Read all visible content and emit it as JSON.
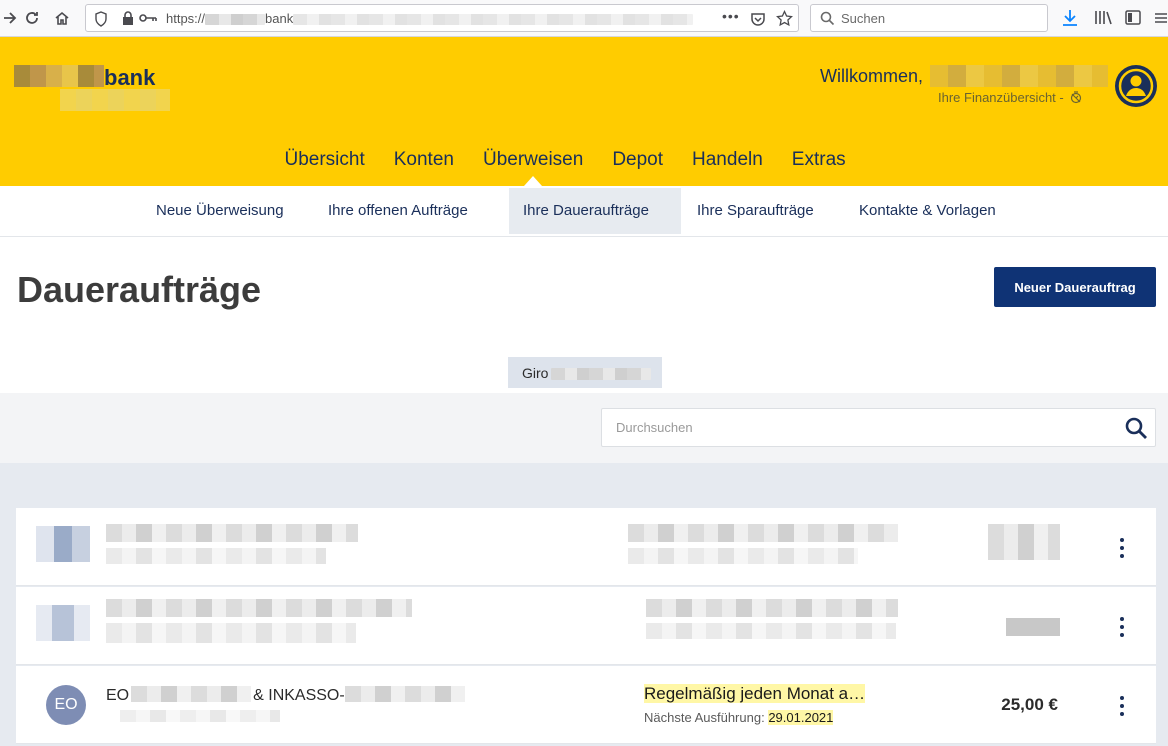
{
  "browser": {
    "url_prefix": "https://",
    "url_visible": "bank",
    "search_placeholder": "Suchen"
  },
  "header": {
    "logo_text": "bank",
    "welcome": "Willkommen,",
    "fin_overview": "Ihre Finanzübersicht -"
  },
  "main_nav": [
    "Übersicht",
    "Konten",
    "Überweisen",
    "Depot",
    "Handeln",
    "Extras"
  ],
  "sub_nav": [
    "Neue Überweisung",
    "Ihre offenen Aufträge",
    "Ihre Daueraufträge",
    "Ihre Sparaufträge",
    "Kontakte & Vorlagen"
  ],
  "page": {
    "title": "Daueraufträge",
    "new_button": "Neuer Dauerauftrag",
    "account_tab": "Giro",
    "search_placeholder": "Durchsuchen"
  },
  "orders": [
    {
      "initials": "EO",
      "name_start": "EO",
      "name_mid": "& INKASSO-",
      "schedule": "Regelmäßig jeden Monat a…",
      "next_label": "Nächste Ausführung:",
      "next_date": "29.01.2021",
      "amount": "25,00 €"
    }
  ],
  "colors": {
    "brand_yellow": "#ffcc00",
    "brand_navy": "#1a2f5a",
    "button_navy": "#0f3375",
    "highlight": "#fff7a6"
  }
}
